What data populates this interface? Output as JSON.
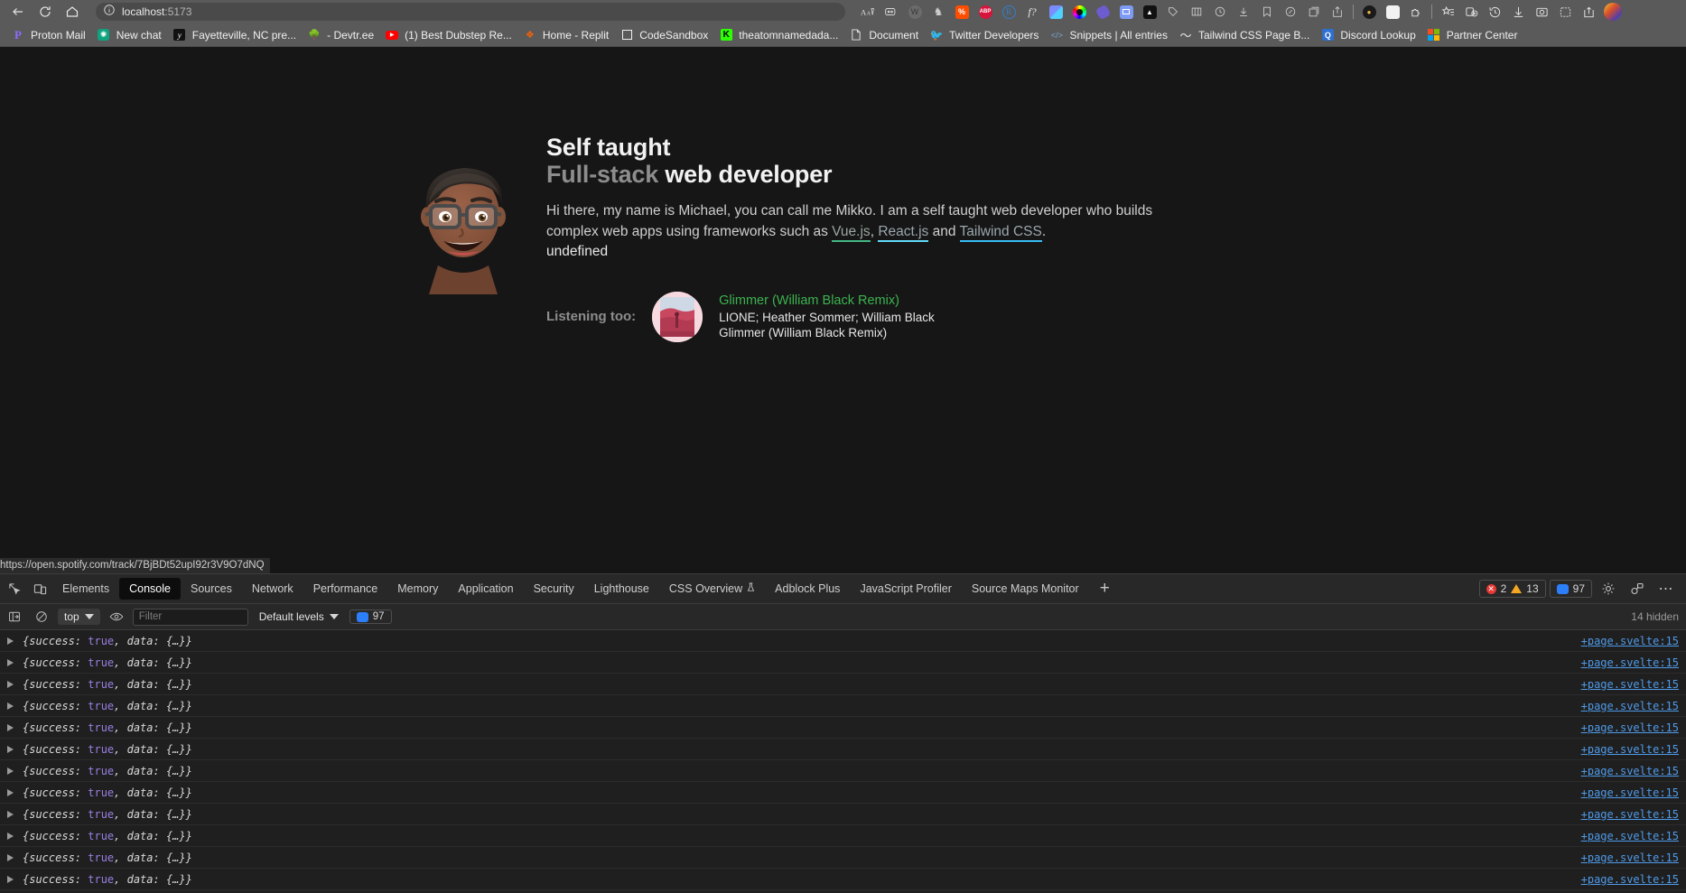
{
  "browser": {
    "nav": {
      "back": "back-arrow",
      "reload": "reload",
      "home": "home"
    },
    "omnibox": {
      "host": "localhost",
      "port": ":5173",
      "info_icon": "info-circle",
      "site_permission_icon": "site-permissions"
    },
    "extensions": [
      {
        "name": "wordpress-extension",
        "color": "#6b6b6b",
        "glyph": "W"
      },
      {
        "name": "grammar-extension",
        "color": "#8a8a8a",
        "glyph": "♞"
      },
      {
        "name": "percent-extension",
        "color": "#ff4d00",
        "glyph": "%"
      },
      {
        "name": "adblock-plus-extension",
        "color": "#d6143c",
        "glyph": "ABP"
      },
      {
        "name": "r-extension",
        "color": "#2f7fd0",
        "glyph": "ℛ"
      },
      {
        "name": "function-extension",
        "color": "#151515",
        "glyph": "ƒ?"
      },
      {
        "name": "color-grid-extension",
        "color": "#6c8cff",
        "glyph": ""
      },
      {
        "name": "camera-extension",
        "color": "#111111",
        "glyph": "◉"
      },
      {
        "name": "pill-extension",
        "color": "#6d5bd0",
        "glyph": ""
      },
      {
        "name": "card-extension",
        "color": "#7f9cf5",
        "glyph": "▤"
      },
      {
        "name": "triangle-extension",
        "color": "#111111",
        "glyph": "▲"
      },
      {
        "name": "tag-extension",
        "color": "#8a8a8a",
        "glyph": "□"
      },
      {
        "name": "film-extension",
        "color": "#8a8a8a",
        "glyph": "◫"
      },
      {
        "name": "clock-extension",
        "color": "#8a8a8a",
        "glyph": "◷"
      },
      {
        "name": "download-extension",
        "color": "#8a8a8a",
        "glyph": "↓"
      },
      {
        "name": "pen-extension",
        "color": "#8a8a8a",
        "glyph": "✎"
      },
      {
        "name": "collections-extension",
        "color": "#8a8a8a",
        "glyph": "⧉"
      },
      {
        "name": "share-extension",
        "color": "#8a8a8a",
        "glyph": "↱"
      }
    ],
    "profile_avatar": "user-avatar"
  },
  "bookmarks": [
    {
      "label": "Proton Mail",
      "icon": "proton-icon",
      "color": "#6d4aff",
      "glyph": "P"
    },
    {
      "label": "New chat",
      "icon": "chatgpt-icon",
      "color": "#10a37f",
      "glyph": "◎"
    },
    {
      "label": "Fayetteville, NC pre...",
      "icon": "weather-icon",
      "color": "#111111",
      "glyph": "☁"
    },
    {
      "label": "- Devtr.ee",
      "icon": "devtree-icon",
      "color": "#2f8f4e",
      "glyph": "☘"
    },
    {
      "label": "(1) Best Dubstep Re...",
      "icon": "youtube-icon",
      "color": "#ff0000",
      "glyph": "▶"
    },
    {
      "label": "Home - Replit",
      "icon": "replit-icon",
      "color": "#f26207",
      "glyph": "❖"
    },
    {
      "label": "CodeSandbox",
      "icon": "codesandbox-icon",
      "color": "#ffffff",
      "glyph": "□"
    },
    {
      "label": "theatomnamedada...",
      "icon": "kofi-icon",
      "color": "#2bff00",
      "glyph": "K"
    },
    {
      "label": "Document",
      "icon": "document-icon",
      "color": "#e6e6e6",
      "glyph": "◯"
    },
    {
      "label": "Twitter Developers",
      "icon": "twitter-icon",
      "color": "#1d9bf0",
      "glyph": "✦"
    },
    {
      "label": "Snippets | All entries",
      "icon": "code-icon",
      "color": "#7aa7d6",
      "glyph": "</>"
    },
    {
      "label": "Tailwind CSS Page B...",
      "icon": "tailwind-icon",
      "color": "#e8e8e8",
      "glyph": "〜"
    },
    {
      "label": "Discord Lookup",
      "icon": "search-icon",
      "color": "#2f6fd0",
      "glyph": "Q"
    },
    {
      "label": "Partner Center",
      "icon": "microsoft-icon",
      "color": "#f25022",
      "glyph": "⊞"
    }
  ],
  "hero": {
    "avatar_icon": "memoji-avatar",
    "title_line1": "Self taught",
    "title_line2_dim": "Full-stack",
    "title_line2_rest": " web developer",
    "bio_part1": "Hi there, my name is Michael, you can call me Mikko. I am a self taught web developer who builds complex web apps using frameworks such as ",
    "link_vue": "Vue.js",
    "bio_sep1": ", ",
    "link_react": "React.js",
    "bio_sep2": " and ",
    "link_tailwind": "Tailwind CSS",
    "bio_end": ".",
    "undefined_text": "undefined",
    "link_colors": {
      "vue": "#42b883",
      "react": "#61dafb",
      "tailwind": "#38bdf8"
    }
  },
  "listening": {
    "label": "Listening too:",
    "album_art_icon": "album-art",
    "track_name": "Glimmer (William Black Remix)",
    "artists": "LIONE; Heather Sommer; William Black",
    "album": "Glimmer (William Black Remix)",
    "track_name_color": "#3cb34f"
  },
  "status_bar": {
    "url": "https://open.spotify.com/track/7BjBDt52upI92r3V9O7dNQ"
  },
  "devtools": {
    "left_icons": [
      {
        "name": "inspect-element-icon"
      },
      {
        "name": "device-toolbar-icon"
      }
    ],
    "tabs": [
      {
        "label": "Elements",
        "active": false
      },
      {
        "label": "Console",
        "active": true
      },
      {
        "label": "Sources",
        "active": false
      },
      {
        "label": "Network",
        "active": false
      },
      {
        "label": "Performance",
        "active": false
      },
      {
        "label": "Memory",
        "active": false
      },
      {
        "label": "Application",
        "active": false
      },
      {
        "label": "Security",
        "active": false
      },
      {
        "label": "Lighthouse",
        "active": false
      },
      {
        "label": "CSS Overview",
        "active": false,
        "badge": "experimental-flask-icon"
      },
      {
        "label": "Adblock Plus",
        "active": false
      },
      {
        "label": "JavaScript Profiler",
        "active": false
      },
      {
        "label": "Source Maps Monitor",
        "active": false
      }
    ],
    "add_tab_label": "+",
    "error_count": "2",
    "warning_count": "13",
    "message_count": "97",
    "settings_icon": "gear-icon",
    "devices_icon": "devices-icon",
    "more_icon": "more-options-icon",
    "filterbar": {
      "sidebar_icon": "console-sidebar-icon",
      "clear_icon": "clear-console-icon",
      "context": "top",
      "eye_icon": "live-expression-icon",
      "filter_placeholder": "Filter",
      "filter_value": "",
      "levels": "Default levels",
      "message_count": "97",
      "hidden_text": "14 hidden"
    },
    "log_message": {
      "prefix": "{",
      "key1": "success: ",
      "val1": "true",
      "sep": ", ",
      "key2": "data: ",
      "val2": "{…}",
      "suffix": "}"
    },
    "log_source": "+page.svelte:15",
    "log_rows": 12
  }
}
